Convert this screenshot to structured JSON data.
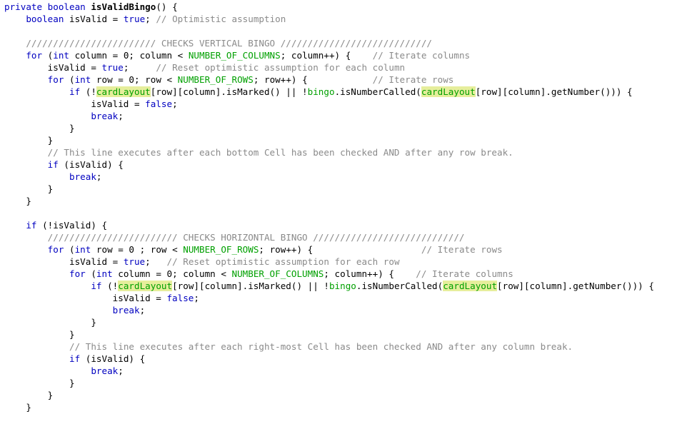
{
  "editor": {
    "lines": [
      [
        {
          "t": "private",
          "s": "keyword"
        },
        {
          "t": " "
        },
        {
          "t": "boolean",
          "s": "keyword"
        },
        {
          "t": " "
        },
        {
          "t": "isValidBingo",
          "s": "method"
        },
        {
          "t": "() {"
        }
      ],
      [
        {
          "t": "    "
        },
        {
          "t": "boolean",
          "s": "keyword"
        },
        {
          "t": " isValid = "
        },
        {
          "t": "true",
          "s": "keyword"
        },
        {
          "t": "; "
        },
        {
          "t": "// Optimistic assumption",
          "s": "comment"
        }
      ],
      [],
      [
        {
          "t": "    "
        },
        {
          "t": "//////////////////////// CHECKS VERTICAL BINGO ////////////////////////////",
          "s": "comment"
        }
      ],
      [
        {
          "t": "    "
        },
        {
          "t": "for",
          "s": "keyword"
        },
        {
          "t": " ("
        },
        {
          "t": "int",
          "s": "keyword"
        },
        {
          "t": " column = 0; column < "
        },
        {
          "t": "NUMBER_OF_COLUMNS",
          "s": "const"
        },
        {
          "t": "; column++) {    "
        },
        {
          "t": "// Iterate columns",
          "s": "comment"
        }
      ],
      [
        {
          "t": "        isValid = "
        },
        {
          "t": "true",
          "s": "keyword"
        },
        {
          "t": ";     "
        },
        {
          "t": "// Reset optimistic assumption for each column",
          "s": "comment"
        }
      ],
      [
        {
          "t": "        "
        },
        {
          "t": "for",
          "s": "keyword"
        },
        {
          "t": " ("
        },
        {
          "t": "int",
          "s": "keyword"
        },
        {
          "t": " row = 0; row < "
        },
        {
          "t": "NUMBER_OF_ROWS",
          "s": "const"
        },
        {
          "t": "; row++) {            "
        },
        {
          "t": "// Iterate rows",
          "s": "comment"
        }
      ],
      [
        {
          "t": "            "
        },
        {
          "t": "if",
          "s": "keyword"
        },
        {
          "t": " (!"
        },
        {
          "t": "cardLayout",
          "s": "hl"
        },
        {
          "t": "[row][column].isMarked() || !"
        },
        {
          "t": "bingo",
          "s": "field"
        },
        {
          "t": ".isNumberCalled("
        },
        {
          "t": "cardLayout",
          "s": "hl"
        },
        {
          "t": "[row][column].getNumber())) {"
        }
      ],
      [
        {
          "t": "                isValid = "
        },
        {
          "t": "false",
          "s": "keyword"
        },
        {
          "t": ";"
        }
      ],
      [
        {
          "t": "                "
        },
        {
          "t": "break",
          "s": "keyword"
        },
        {
          "t": ";"
        }
      ],
      [
        {
          "t": "            }"
        }
      ],
      [
        {
          "t": "        }"
        }
      ],
      [
        {
          "t": "        "
        },
        {
          "t": "// This line executes after each bottom Cell has been checked AND after any row break.",
          "s": "comment"
        }
      ],
      [
        {
          "t": "        "
        },
        {
          "t": "if",
          "s": "keyword"
        },
        {
          "t": " (isValid) {"
        }
      ],
      [
        {
          "t": "            "
        },
        {
          "t": "break",
          "s": "keyword"
        },
        {
          "t": ";"
        }
      ],
      [
        {
          "t": "        }"
        }
      ],
      [
        {
          "t": "    }"
        }
      ],
      [],
      [
        {
          "t": "    "
        },
        {
          "t": "if",
          "s": "keyword"
        },
        {
          "t": " (!isValid) {"
        }
      ],
      [
        {
          "t": "        "
        },
        {
          "t": "//////////////////////// CHECKS HORIZONTAL BINGO ////////////////////////////",
          "s": "comment"
        }
      ],
      [
        {
          "t": "        "
        },
        {
          "t": "for",
          "s": "keyword"
        },
        {
          "t": " ("
        },
        {
          "t": "int",
          "s": "keyword"
        },
        {
          "t": " row = 0 ; row < "
        },
        {
          "t": "NUMBER_OF_ROWS",
          "s": "const"
        },
        {
          "t": "; row++) {                    "
        },
        {
          "t": "// Iterate rows",
          "s": "comment"
        }
      ],
      [
        {
          "t": "            isValid = "
        },
        {
          "t": "true",
          "s": "keyword"
        },
        {
          "t": ";   "
        },
        {
          "t": "// Reset optimistic assumption for each row",
          "s": "comment"
        }
      ],
      [
        {
          "t": "            "
        },
        {
          "t": "for",
          "s": "keyword"
        },
        {
          "t": " ("
        },
        {
          "t": "int",
          "s": "keyword"
        },
        {
          "t": " column = 0; column < "
        },
        {
          "t": "NUMBER_OF_COLUMNS",
          "s": "const"
        },
        {
          "t": "; column++) {    "
        },
        {
          "t": "// Iterate columns",
          "s": "comment"
        }
      ],
      [
        {
          "t": "                "
        },
        {
          "t": "if",
          "s": "keyword"
        },
        {
          "t": " (!"
        },
        {
          "t": "cardLayout",
          "s": "hl"
        },
        {
          "t": "[row][column].isMarked() || !"
        },
        {
          "t": "bingo",
          "s": "field"
        },
        {
          "t": ".isNumberCalled("
        },
        {
          "t": "cardLayout",
          "s": "hl"
        },
        {
          "t": "[row][column].getNumber())) {"
        }
      ],
      [
        {
          "t": "                    isValid = "
        },
        {
          "t": "false",
          "s": "keyword"
        },
        {
          "t": ";"
        }
      ],
      [
        {
          "t": "                    "
        },
        {
          "t": "break",
          "s": "keyword"
        },
        {
          "t": ";"
        }
      ],
      [
        {
          "t": "                }"
        }
      ],
      [
        {
          "t": "            }"
        }
      ],
      [
        {
          "t": "            "
        },
        {
          "t": "// This line executes after each right-most Cell has been checked AND after any column break.",
          "s": "comment"
        }
      ],
      [
        {
          "t": "            "
        },
        {
          "t": "if",
          "s": "keyword"
        },
        {
          "t": " (isValid) {"
        }
      ],
      [
        {
          "t": "                "
        },
        {
          "t": "break",
          "s": "keyword"
        },
        {
          "t": ";"
        }
      ],
      [
        {
          "t": "            }"
        }
      ],
      [
        {
          "t": "        }"
        }
      ],
      [
        {
          "t": "    }"
        }
      ]
    ]
  },
  "colors": {
    "background": "#ffffff",
    "keyword": "#0000C0",
    "comment": "#8a8a8a",
    "constant": "#00A000",
    "highlight_bg": "#E6EE9C"
  }
}
